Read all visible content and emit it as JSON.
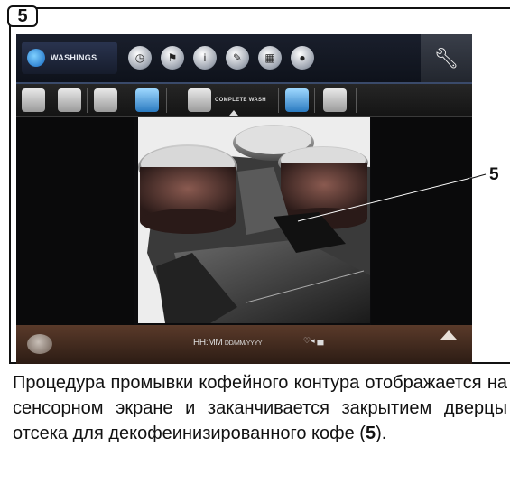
{
  "step": {
    "number": "5"
  },
  "screen": {
    "washings_label": "WASHINGS",
    "top_icons": [
      "clock-icon",
      "flag-icon",
      "info-icon",
      "pencil-icon",
      "calendar-icon",
      "user-icon"
    ],
    "tools_icon": "wrench-icon",
    "sub_icons_left": [
      "cup-wash-icon",
      "cup-icon",
      "milk-icon",
      "glass-icon"
    ],
    "complete_wash_label": "COMPLETE WASH",
    "sub_icons_right": [
      "glass-icon",
      "decaf-cup-icon"
    ],
    "datetime_main": "HH:MM",
    "datetime_small": "DD/MM/YYYY",
    "status_text": "♡◂ ▄"
  },
  "callout": {
    "number": "5"
  },
  "caption": {
    "text": "Процедура промывки кофейного контура отображается на сенсорном экране и заканчивается закрытием дверцы отсека для декофеинизированного кофе (",
    "ref": "5",
    "end": ")."
  }
}
